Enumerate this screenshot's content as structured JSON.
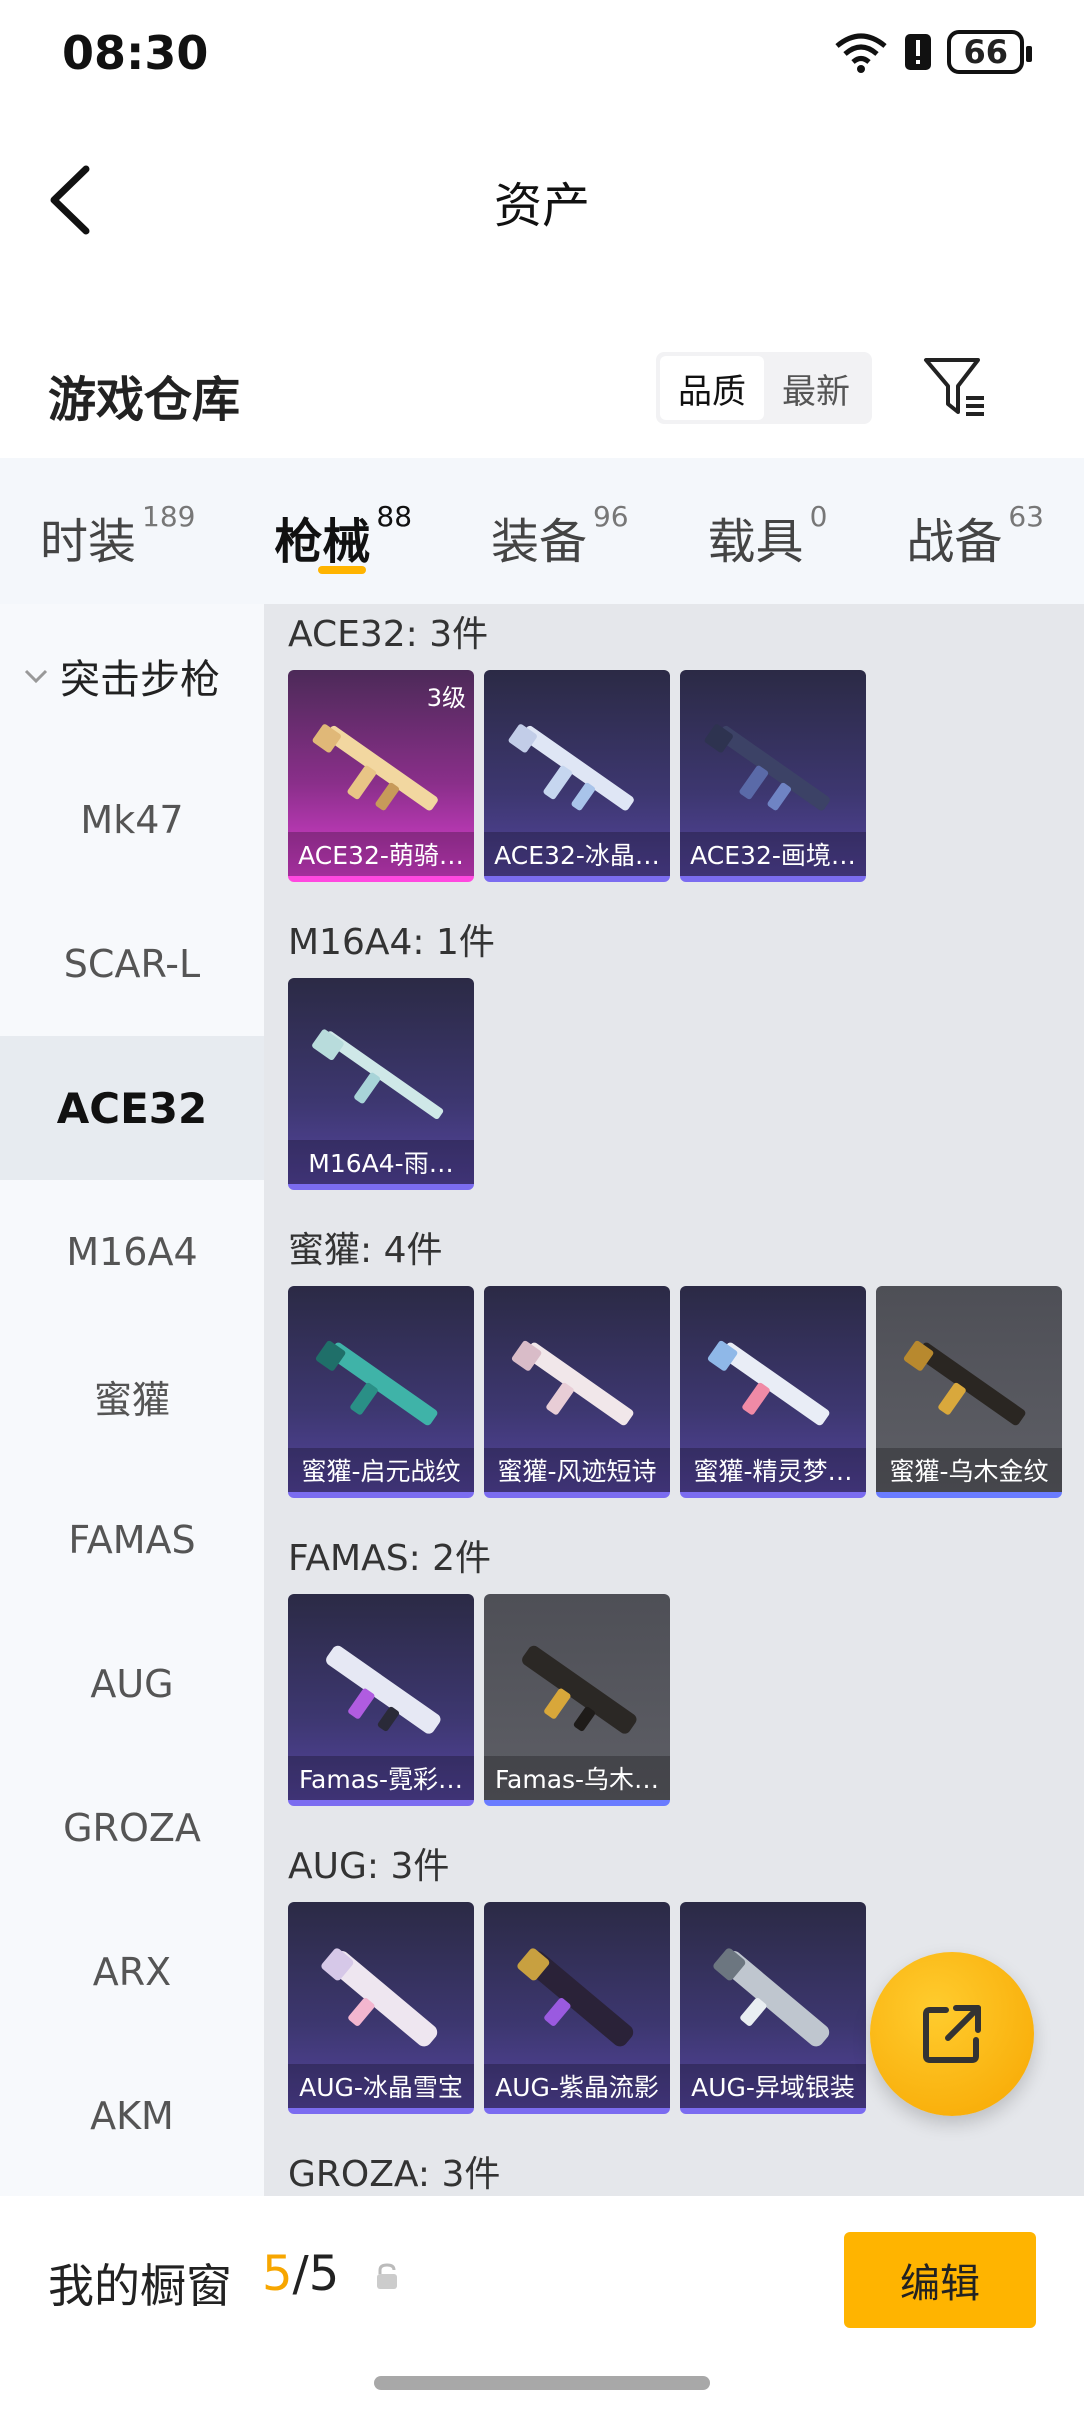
{
  "status": {
    "time": "08:30",
    "battery": "66"
  },
  "header": {
    "title": "资产"
  },
  "section": {
    "title": "游戏仓库",
    "sort_options": [
      "品质",
      "最新"
    ]
  },
  "tabs": [
    {
      "label": "时装",
      "count": "189"
    },
    {
      "label": "枪械",
      "count": "88"
    },
    {
      "label": "装备",
      "count": "96"
    },
    {
      "label": "载具",
      "count": "0"
    },
    {
      "label": "战备",
      "count": "63"
    }
  ],
  "sidebar": {
    "group": "突击步枪",
    "items": [
      "Mk47",
      "SCAR-L",
      "ACE32",
      "M16A4",
      "蜜獾",
      "FAMAS",
      "AUG",
      "GROZA",
      "ARX",
      "AKM"
    ]
  },
  "groups": [
    {
      "title": "ACE32: 3件",
      "items": [
        {
          "name": "ACE32-萌骑…",
          "level": "3级",
          "style": "pink"
        },
        {
          "name": "ACE32-冰晶…",
          "style": "purple"
        },
        {
          "name": "ACE32-画境…",
          "style": "purple"
        }
      ]
    },
    {
      "title": "M16A4: 1件",
      "items": [
        {
          "name": "M16A4-雨…",
          "style": "purple"
        }
      ]
    },
    {
      "title": "蜜獾: 4件",
      "items": [
        {
          "name": "蜜獾-启元战纹",
          "style": "purple"
        },
        {
          "name": "蜜獾-风迹短诗",
          "style": "purple"
        },
        {
          "name": "蜜獾-精灵梦…",
          "style": "purple"
        },
        {
          "name": "蜜獾-乌木金纹",
          "style": "gray"
        }
      ]
    },
    {
      "title": "FAMAS: 2件",
      "items": [
        {
          "name": "Famas-霓彩…",
          "style": "purple"
        },
        {
          "name": "Famas-乌木…",
          "style": "gray"
        }
      ]
    },
    {
      "title": "AUG: 3件",
      "items": [
        {
          "name": "AUG-冰晶雪宝",
          "style": "purple"
        },
        {
          "name": "AUG-紫晶流影",
          "style": "purple"
        },
        {
          "name": "AUG-异域银装",
          "style": "purple"
        }
      ]
    },
    {
      "title": "GROZA: 3件",
      "items": []
    }
  ],
  "bottom": {
    "label": "我的橱窗",
    "count_current": "5",
    "count_sep": "/",
    "count_total": "5",
    "edit_label": "编辑"
  },
  "colors": {
    "accent": "#ffb400",
    "card_purple": "#54449d",
    "card_pink": "#d93fd0"
  }
}
